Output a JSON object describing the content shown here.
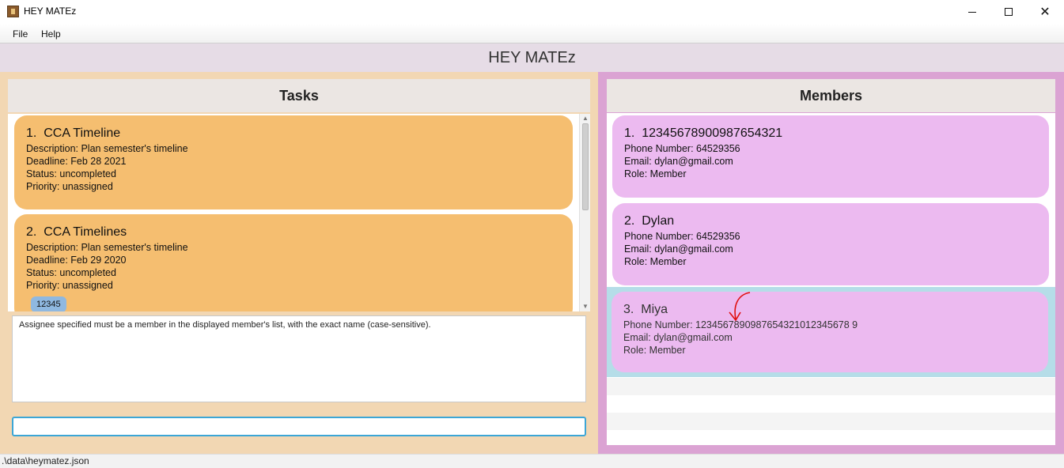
{
  "window": {
    "title": "HEY MATEz",
    "minimize_glyph": "",
    "maximize_glyph": "",
    "close_glyph": "✕"
  },
  "menu": {
    "items": [
      "File",
      "Help"
    ]
  },
  "app": {
    "header": "HEY MATEz"
  },
  "tasks": {
    "header": "Tasks",
    "items": [
      {
        "index": "1.",
        "title": "CCA Timeline",
        "description": "Description: Plan semester's timeline",
        "deadline": "Deadline: Feb 28 2021",
        "status": "Status: uncompleted",
        "priority": "Priority: unassigned",
        "tags": []
      },
      {
        "index": "2.",
        "title": "CCA Timelines",
        "description": "Description: Plan semester's timeline",
        "deadline": "Deadline: Feb 29 2020",
        "status": "Status: uncompleted",
        "priority": "Priority: unassigned",
        "tags": [
          "12345"
        ]
      }
    ]
  },
  "result": {
    "text": "Assignee specified must be a member in the displayed member's list, with the exact name (case-sensitive)."
  },
  "command": {
    "value": "",
    "placeholder": ""
  },
  "members": {
    "header": "Members",
    "items": [
      {
        "index": "1.",
        "name": "12345678900987654321",
        "phone": "Phone Number: 64529356",
        "email": "Email: dylan@gmail.com",
        "role": "Role: Member"
      },
      {
        "index": "2.",
        "name": "Dylan",
        "phone": "Phone Number: 64529356",
        "email": "Email: dylan@gmail.com",
        "role": "Role: Member"
      },
      {
        "index": "3.",
        "name": "Miya",
        "phone": "Phone Number: 1234567890987654321012345678 9",
        "email": "Email: dylan@gmail.com",
        "role": "Role: Member"
      }
    ]
  },
  "status_bar": {
    "path": ".\\data\\heymatez.json"
  },
  "colors": {
    "task_card": "#f5be70",
    "member_card": "#ecbaf0",
    "selected_member_row": "#b5dde8",
    "left_pane": "#f2d7b3",
    "right_pane": "#dba3d3",
    "tag": "#8fb8e0",
    "annotation_arrow": "#e01010"
  }
}
